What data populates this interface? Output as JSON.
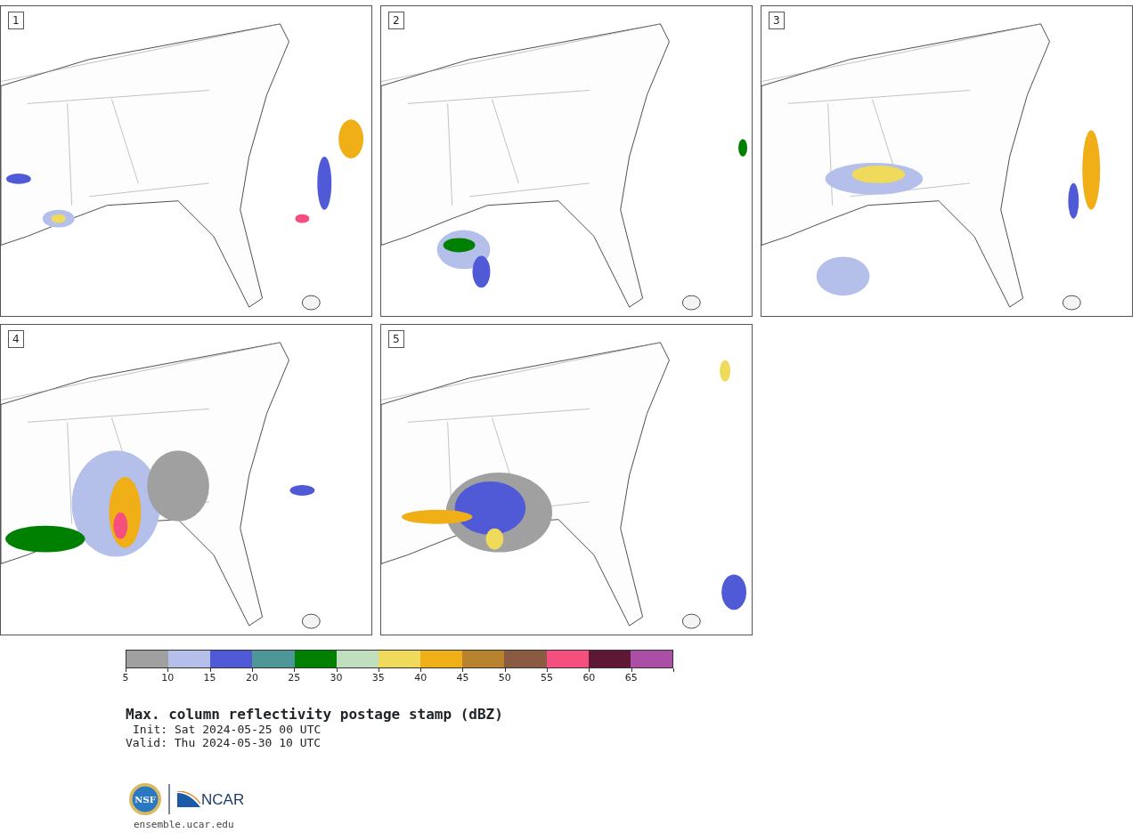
{
  "panels": [
    {
      "label": "1"
    },
    {
      "label": "2"
    },
    {
      "label": "3"
    },
    {
      "label": "4"
    },
    {
      "label": "5"
    }
  ],
  "colorbar": [
    {
      "tick": "5",
      "color": "#a0a0a0"
    },
    {
      "tick": "10",
      "color": "#b4bfea"
    },
    {
      "tick": "15",
      "color": "#505ad6"
    },
    {
      "tick": "20",
      "color": "#4e9799"
    },
    {
      "tick": "25",
      "color": "#008000"
    },
    {
      "tick": "30",
      "color": "#bfdfbf"
    },
    {
      "tick": "35",
      "color": "#f0da5c"
    },
    {
      "tick": "40",
      "color": "#f0ae17"
    },
    {
      "tick": "45",
      "color": "#b8822e"
    },
    {
      "tick": "50",
      "color": "#8a5b40"
    },
    {
      "tick": "55",
      "color": "#f44f7f"
    },
    {
      "tick": "60",
      "color": "#5e1834"
    },
    {
      "tick": "65",
      "color": "#ab4fa6"
    }
  ],
  "title": "Max. column reflectivity postage stamp (dBZ)",
  "init": "Init: Sat 2024-05-25 00 UTC",
  "valid": "Valid: Thu 2024-05-30 10 UTC",
  "logos": {
    "seal": "NSF",
    "brand": "NCAR"
  },
  "footer": "ensemble.ucar.edu"
}
